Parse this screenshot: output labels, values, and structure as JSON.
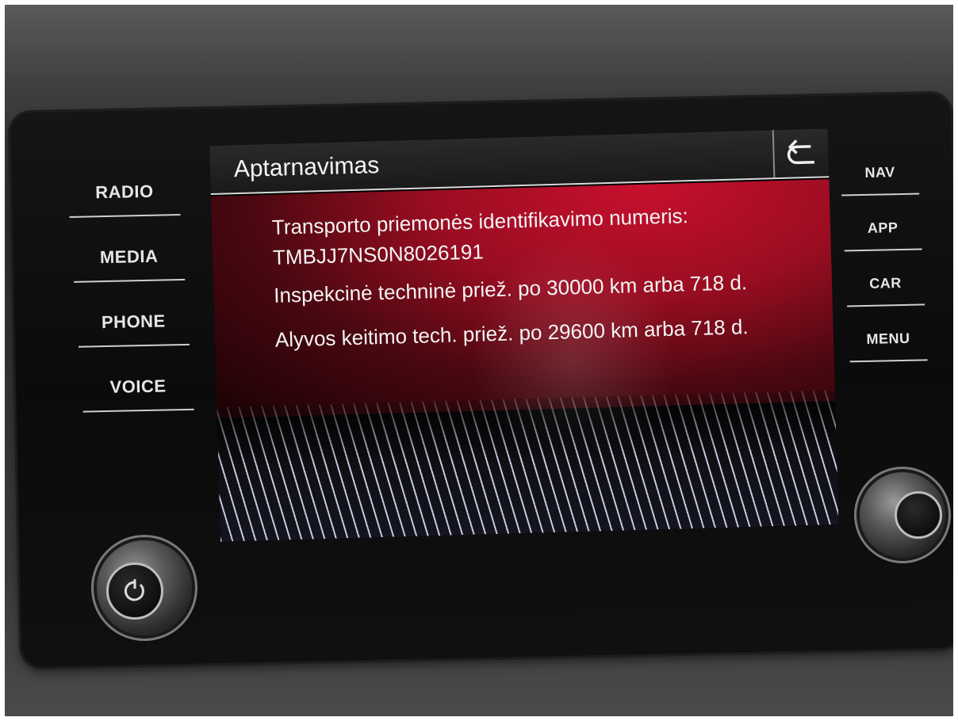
{
  "left_menu": [
    "RADIO",
    "MEDIA",
    "PHONE",
    "VOICE"
  ],
  "right_menu": [
    "NAV",
    "APP",
    "CAR",
    "MENU"
  ],
  "screen": {
    "title": "Aptarnavimas",
    "lines": [
      "Transporto priemonės identifikavimo numeris:",
      "TMBJJ7NS0N8026191",
      "Inspekcinė techninė priež. po 30000 km arba 718 d.",
      "Alyvos keitimo tech. priež. po 29600 km arba 718 d."
    ]
  },
  "icons": {
    "back": "back-arrow-icon",
    "power": "power-icon"
  },
  "colors": {
    "content_accent": "#c8102e",
    "title_bar": "#1f1f1f",
    "text": "#f4f4f4"
  }
}
